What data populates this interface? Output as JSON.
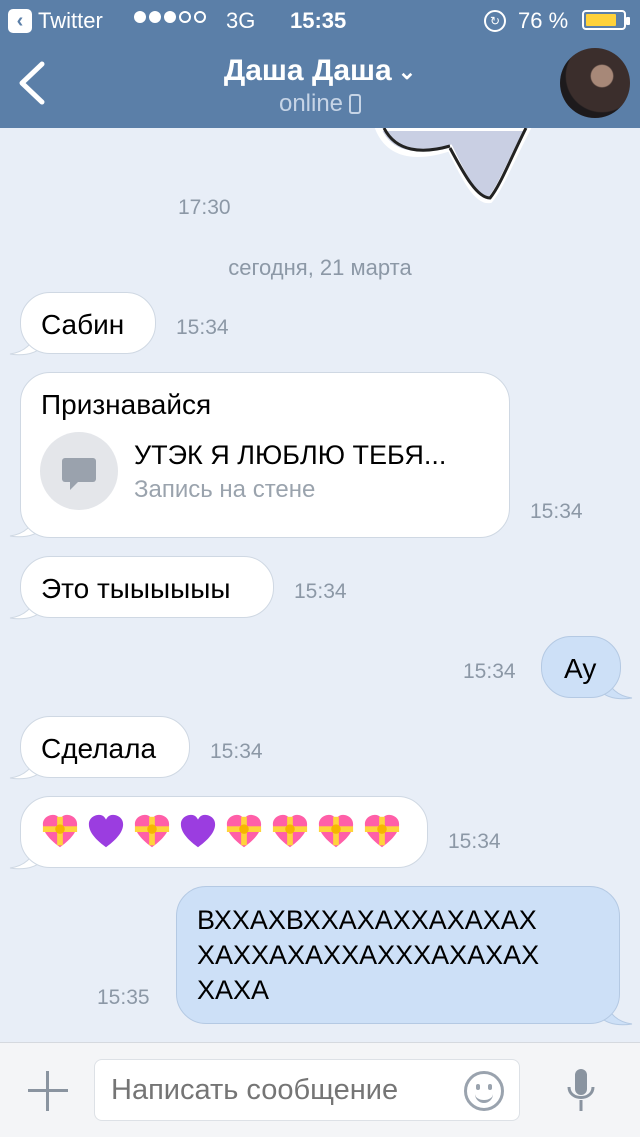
{
  "status_bar": {
    "app_back": "Twitter",
    "network": "3G",
    "time": "15:35",
    "battery": "76 %"
  },
  "header": {
    "title": "Даша Даша",
    "subtitle": "online"
  },
  "timestamps": {
    "sticker": "17:30"
  },
  "date_divider": "сегодня, 21 марта",
  "messages": [
    {
      "dir": "in",
      "text": "Сабин",
      "time": "15:34"
    },
    {
      "dir": "in",
      "text": "Признавайся",
      "attachment_title": "УТЭК Я ЛЮБЛЮ ТЕБЯ...",
      "attachment_type": "Запись на стене",
      "time": "15:34"
    },
    {
      "dir": "in",
      "text": "Это тыыыыыы",
      "time": "15:34"
    },
    {
      "dir": "out",
      "text": "Ау",
      "time": "15:34"
    },
    {
      "dir": "in",
      "text": "Сделала",
      "time": "15:34"
    },
    {
      "dir": "in",
      "emoji": [
        "heart-ribbon-icon",
        "purple-heart-icon",
        "heart-ribbon-icon",
        "purple-heart-icon",
        "heart-ribbon-icon",
        "heart-ribbon-icon",
        "heart-ribbon-icon",
        "heart-ribbon-icon"
      ],
      "time": "15:34"
    },
    {
      "dir": "out",
      "lines": [
        "ВХХАХВХХАХАХХАХАХАХ",
        "ХАХХАХАХХАХХХАХАХАХ",
        "ХАХА"
      ],
      "time": "15:35"
    }
  ],
  "composer": {
    "placeholder": "Написать сообщение"
  },
  "colors": {
    "header_bg": "#5b7fa8",
    "chat_bg": "#e8eef7",
    "outgoing_bubble": "#cde0f7",
    "incoming_bubble": "#ffffff"
  }
}
